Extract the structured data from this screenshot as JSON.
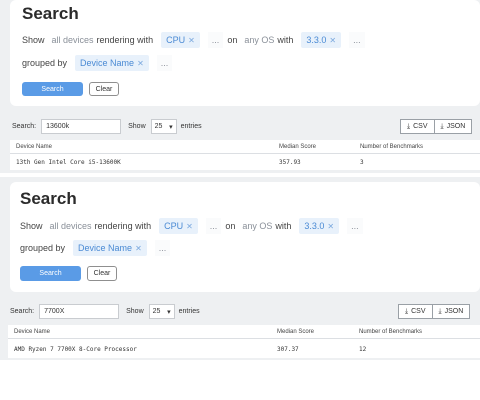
{
  "panels": [
    {
      "title": "Search",
      "filters": {
        "show_label": "Show",
        "device_scope": "all devices",
        "rendering_label": "rendering with",
        "renderer": "CPU",
        "ellipsis": "...",
        "on_label": "on",
        "os_scope": "any OS",
        "with_label": "with",
        "version": "3.3.0",
        "grouped_label": "grouped by",
        "group": "Device Name"
      },
      "search_button": "Search",
      "clear_button": "Clear",
      "toolbar": {
        "search_label": "Search:",
        "search_value": "13600k",
        "show_label": "Show",
        "entries_value": "25",
        "entries_label": "entries",
        "csv": "CSV",
        "json": "JSON"
      },
      "table": {
        "columns": [
          "Device Name",
          "Median Score",
          "Number of Benchmarks"
        ],
        "rows": [
          [
            "13th Gen Intel Core i5-13600K",
            "357.93",
            "3"
          ]
        ]
      }
    },
    {
      "title": "Search",
      "filters": {
        "show_label": "Show",
        "device_scope": "all devices",
        "rendering_label": "rendering with",
        "renderer": "CPU",
        "ellipsis": "...",
        "on_label": "on",
        "os_scope": "any OS",
        "with_label": "with",
        "version": "3.3.0",
        "grouped_label": "grouped by",
        "group": "Device Name"
      },
      "search_button": "Search",
      "clear_button": "Clear",
      "toolbar": {
        "search_label": "Search:",
        "search_value": "7700X",
        "show_label": "Show",
        "entries_value": "25",
        "entries_label": "entries",
        "csv": "CSV",
        "json": "JSON"
      },
      "table": {
        "columns": [
          "Device Name",
          "Median Score",
          "Number of Benchmarks"
        ],
        "rows": [
          [
            "AMD Ryzen 7 7700X 8-Core Processor",
            "307.37",
            "12"
          ]
        ]
      }
    }
  ],
  "colors": {
    "accent": "#5a9be6",
    "tag_bg": "#e8f1fb",
    "tag_text": "#4a8ad4",
    "page_bg": "#eef0f2"
  }
}
